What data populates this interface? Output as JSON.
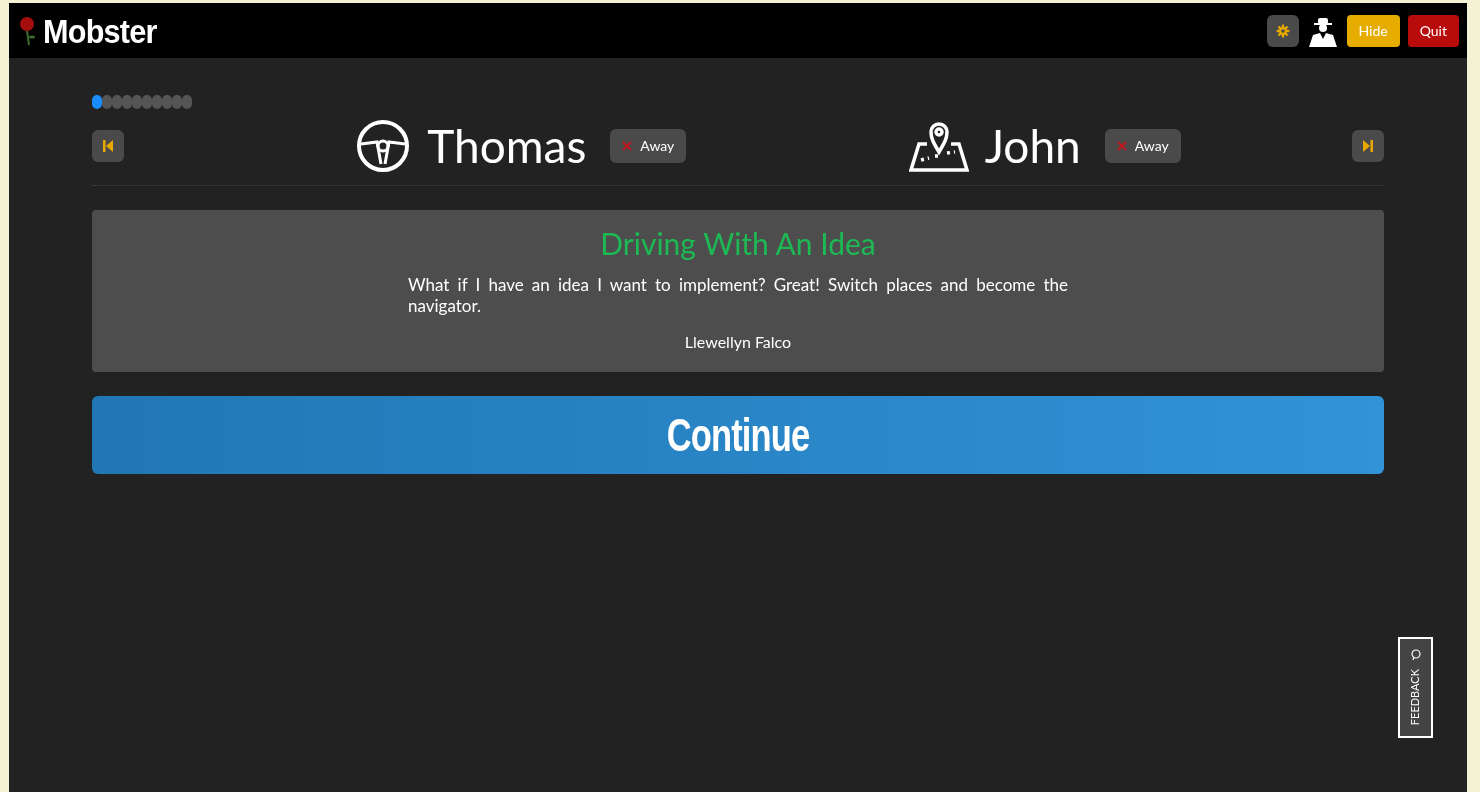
{
  "app": {
    "title": "Mobster"
  },
  "header_buttons": [
    {
      "kind": "settings"
    },
    {
      "kind": "mobster"
    },
    {
      "kind": "hide",
      "label": "Hide"
    },
    {
      "kind": "quit",
      "label": "Quit"
    }
  ],
  "progress": [
    {
      "selected": true
    },
    {
      "selected": false
    },
    {
      "selected": false
    },
    {
      "selected": false
    },
    {
      "selected": false
    },
    {
      "selected": false
    },
    {
      "selected": false
    },
    {
      "selected": false
    },
    {
      "selected": false
    },
    {
      "selected": false
    }
  ],
  "roles": [
    {
      "kind": "driver",
      "name": "Thomas",
      "away_label": "Away"
    },
    {
      "kind": "navigator",
      "name": "John",
      "away_label": "Away"
    }
  ],
  "tip": {
    "title": "Driving With An Idea",
    "body": "What if I have an idea I want to implement? Great! Switch places and become the navigator.",
    "author": "Llewellyn Falco"
  },
  "continue_button": "Continue",
  "feedback": "FEEDBACK"
}
